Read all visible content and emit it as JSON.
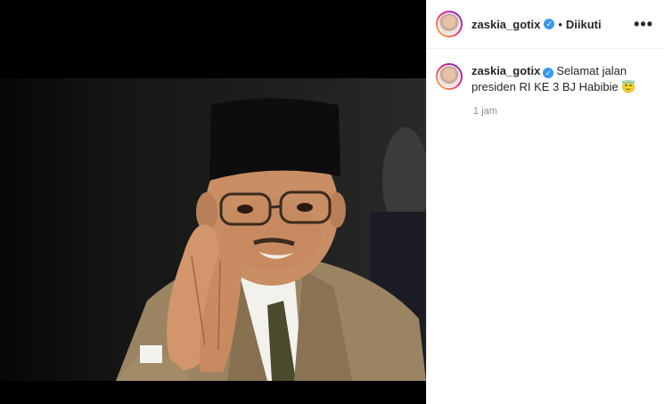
{
  "header": {
    "username": "zaskia_gotix",
    "separator": "•",
    "follow_status": "Diikuti",
    "more_icon": "more-horizontal-icon",
    "verified_icon": "verified-badge-icon"
  },
  "caption": {
    "username": "zaskia_gotix",
    "text": "Selamat jalan presiden RI KE 3 BJ Habibie 😇",
    "timestamp": "1 jam"
  },
  "colors": {
    "verified_blue": "#3897f0",
    "text": "#262626",
    "muted": "#8e8e8e"
  }
}
